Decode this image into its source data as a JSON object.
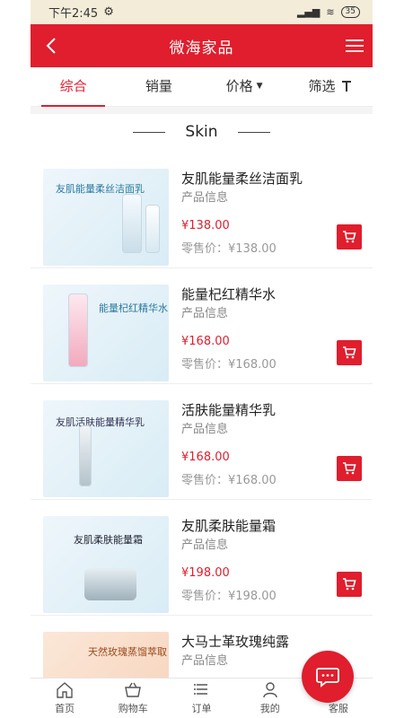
{
  "status_bar": {
    "time": "下午2:45",
    "battery": "35"
  },
  "header": {
    "title": "微海家品"
  },
  "tabs": [
    {
      "label": "综合",
      "active": true
    },
    {
      "label": "销量",
      "active": false
    },
    {
      "label": "价格",
      "active": false,
      "icon": "sort-triangle-icon"
    },
    {
      "label": "筛选",
      "active": false,
      "icon": "filter-icon"
    }
  ],
  "section": {
    "title": "Skin"
  },
  "products": [
    {
      "name": "友肌能量柔丝洁面乳",
      "subtitle": "产品信息",
      "price": "¥138.00",
      "retail": "零售价：¥138.00",
      "image_text": "友肌能量柔丝洁面乳"
    },
    {
      "name": "能量杞红精华水",
      "subtitle": "产品信息",
      "price": "¥168.00",
      "retail": "零售价：¥168.00",
      "image_text": "能量杞红精华水"
    },
    {
      "name": "活肤能量精华乳",
      "subtitle": "产品信息",
      "price": "¥168.00",
      "retail": "零售价：¥168.00",
      "image_text": "友肌活肤能量精华乳"
    },
    {
      "name": "友肌柔肤能量霜",
      "subtitle": "产品信息",
      "price": "¥198.00",
      "retail": "零售价：¥198.00",
      "image_text": "友肌柔肤能量霜"
    },
    {
      "name": "大马士革玫瑰纯露",
      "subtitle": "产品信息",
      "price": "",
      "retail": "",
      "image_text": "天然玫瑰蒸馏萃取"
    }
  ],
  "bottom_nav": [
    {
      "label": "首页",
      "icon": "home-icon"
    },
    {
      "label": "购物车",
      "icon": "basket-icon"
    },
    {
      "label": "订单",
      "icon": "order-list-icon"
    },
    {
      "label": "我的",
      "icon": "user-icon"
    },
    {
      "label": "客服",
      "icon": "chat-icon"
    }
  ],
  "colors": {
    "brand_red": "#e01e2d",
    "status_bg": "#f3ecd9"
  }
}
